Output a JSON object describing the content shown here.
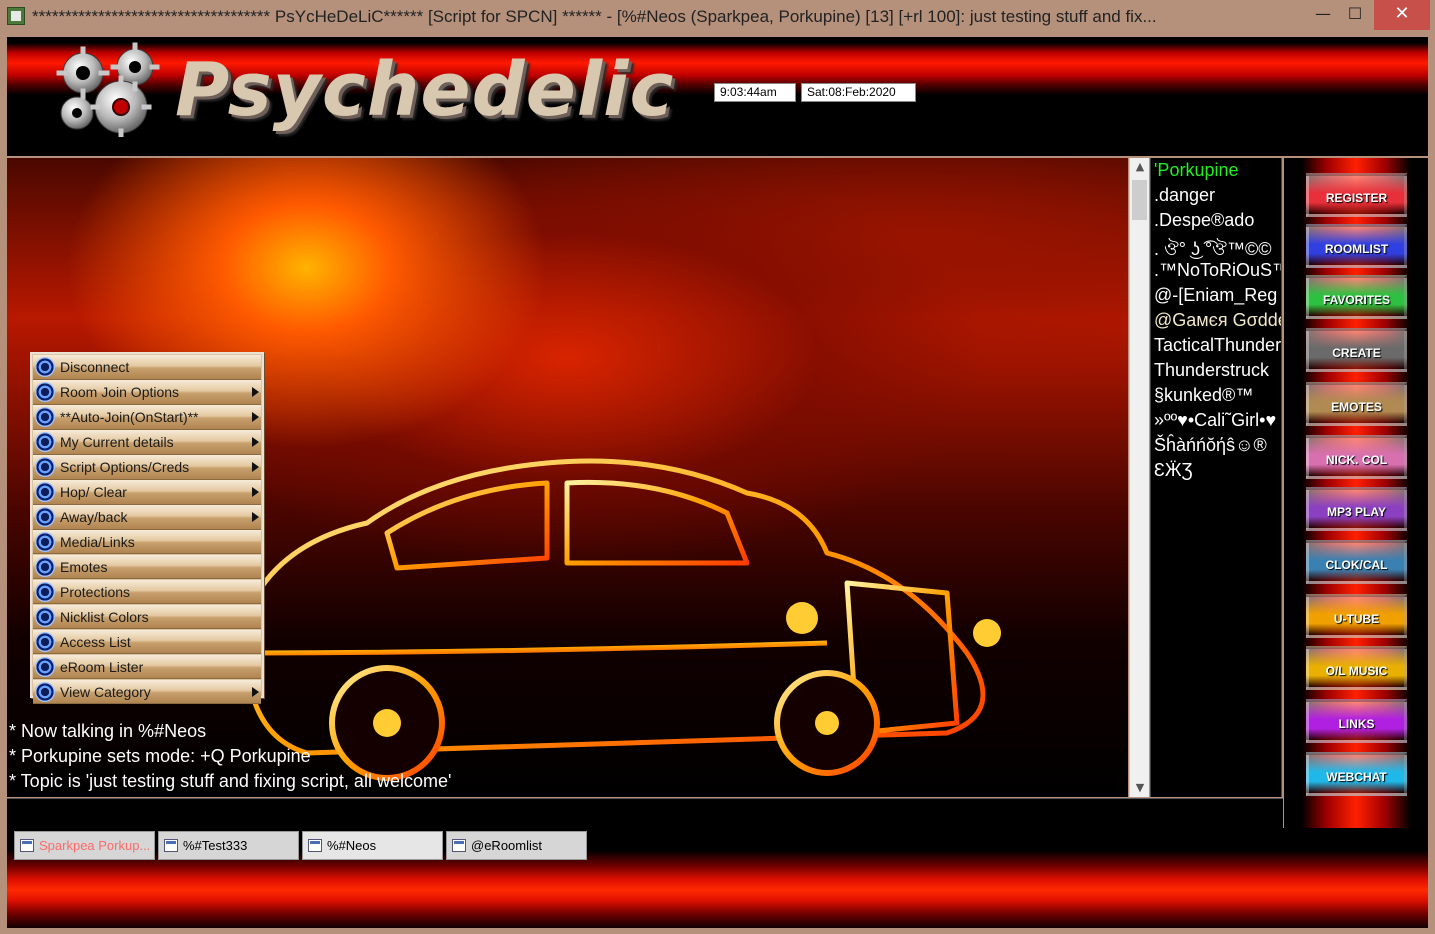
{
  "window": {
    "title": "************************************ PsYcHeDeLiC****** [Script for SPCN] ****** - [%#Neos (Sparkpea, Porkupine) [13] [+rl 100]: just testing stuff and fix...",
    "min_glyph": "—",
    "max_glyph": "☐",
    "close_glyph": "✕"
  },
  "header": {
    "logo_text": "Psychedelic",
    "time": "9:03:44am",
    "date": "Sat:08:Feb:2020"
  },
  "chat": {
    "lines": [
      "* Now talking in %#Neos",
      "* Porkupine sets mode: +Q Porkupine",
      "* Topic is 'just testing stuff and fixing script, all welcome'"
    ]
  },
  "menu": {
    "items": [
      {
        "label": "Disconnect",
        "submenu": false
      },
      {
        "label": "Room Join Options",
        "submenu": true
      },
      {
        "label": "**Auto-Join(OnStart)**",
        "submenu": true
      },
      {
        "label": "My Current details",
        "submenu": true
      },
      {
        "label": "Script Options/Creds",
        "submenu": true
      },
      {
        "label": "Hop/ Clear",
        "submenu": true
      },
      {
        "label": "Away/back",
        "submenu": true
      },
      {
        "label": "Media/Links",
        "submenu": false
      },
      {
        "label": "Emotes",
        "submenu": false
      },
      {
        "label": "Protections",
        "submenu": false
      },
      {
        "label": "Nicklist Colors",
        "submenu": false
      },
      {
        "label": "Access List",
        "submenu": false
      },
      {
        "label": "eRoom Lister",
        "submenu": false
      },
      {
        "label": "View Category",
        "submenu": true
      }
    ]
  },
  "nicklist": {
    "nicks": [
      {
        "text": "'Porkupine",
        "color": "#22ee22"
      },
      {
        "text": ".danger",
        "color": "#ffffff"
      },
      {
        "text": ".Despe®ado",
        "color": "#ffffff"
      },
      {
        "text": ". ঔ° ͜ʖ ͡°ঔ™©©",
        "color": "#ffffff"
      },
      {
        "text": ".™NoToRiOuS™",
        "color": "#ffffff"
      },
      {
        "text": "@-[Eniam_Reg",
        "color": "#ffffff"
      },
      {
        "text": "@Gамєя Gσddє",
        "color": "#f2e8c8"
      },
      {
        "text": "TacticalThunder",
        "color": "#ffffff"
      },
      {
        "text": "Thunderstruck",
        "color": "#ffffff"
      },
      {
        "text": "§kunked®™",
        "color": "#ffffff"
      },
      {
        "text": "»ºº♥•Cali˜Girl•♥",
        "color": "#ffffff"
      },
      {
        "text": "Šĥàńńŏήŝ☺®",
        "color": "#ffffff"
      },
      {
        "text": "ƐӜƷ",
        "color": "#ffffff"
      }
    ]
  },
  "buttons": [
    {
      "label": "REGISTER",
      "color": "#e8303a"
    },
    {
      "label": "ROOMLIST",
      "color": "#3040e0"
    },
    {
      "label": "FAVORITES",
      "color": "#2ec040"
    },
    {
      "label": "CREATE",
      "color": "#6a6a6a"
    },
    {
      "label": "EMOTES",
      "color": "#b08a50"
    },
    {
      "label": "NICK. COL",
      "color": "#d870b0"
    },
    {
      "label": "MP3 PLAY",
      "color": "#8a40c0"
    },
    {
      "label": "CLOK/CAL",
      "color": "#3a80b0"
    },
    {
      "label": "U-TUBE",
      "color": "#f0a000"
    },
    {
      "label": "O/L MUSIC",
      "color": "#e8b000"
    },
    {
      "label": "LINKS",
      "color": "#b020e0"
    },
    {
      "label": "WEBCHAT",
      "color": "#20b8e8"
    }
  ],
  "tabs": [
    {
      "label": "Sparkpea Porkup..."
    },
    {
      "label": "%#Test333"
    },
    {
      "label": "%#Neos"
    },
    {
      "label": "@eRoomlist"
    }
  ]
}
